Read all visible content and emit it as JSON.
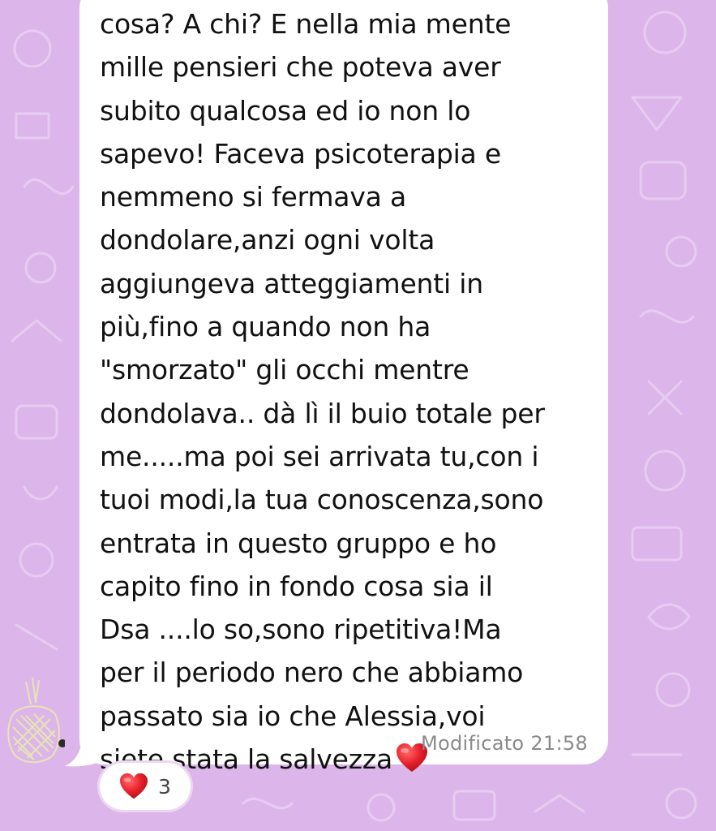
{
  "chat": {
    "message": {
      "lines": [
        "cosa? A chi? E nella mia mente",
        "mille pensieri che poteva aver",
        "subito qualcosa ed io non lo",
        "sapevo! Faceva psicoterapia e",
        "nemmeno si fermava a",
        "dondolare,anzi ogni volta",
        "aggiungeva atteggiamenti in",
        "più,fino a quando non ha",
        "\"smorzato\" gli occhi mentre",
        "dondolava.. dà lì il buio totale per",
        "me.....ma poi sei arrivata tu,con i",
        "tuoi modi,la tua conoscenza,sono",
        "entrata in questo gruppo e ho",
        "capito fino in fondo cosa sia il",
        "Dsa ....lo so,sono ripetitiva!Ma",
        "per il periodo nero che abbiamo",
        "passato sia io che Alessia,voi",
        "siete stata la salvezza"
      ],
      "emoji": "red-heart-emoji",
      "edited_label": "Modificato",
      "time": "21:58"
    },
    "reaction": {
      "emoji": "red-heart-emoji",
      "count": "3"
    }
  },
  "colors": {
    "wallpaper": "#dcb6ea",
    "bubble": "#ffffff",
    "heart": "#e8202b"
  }
}
